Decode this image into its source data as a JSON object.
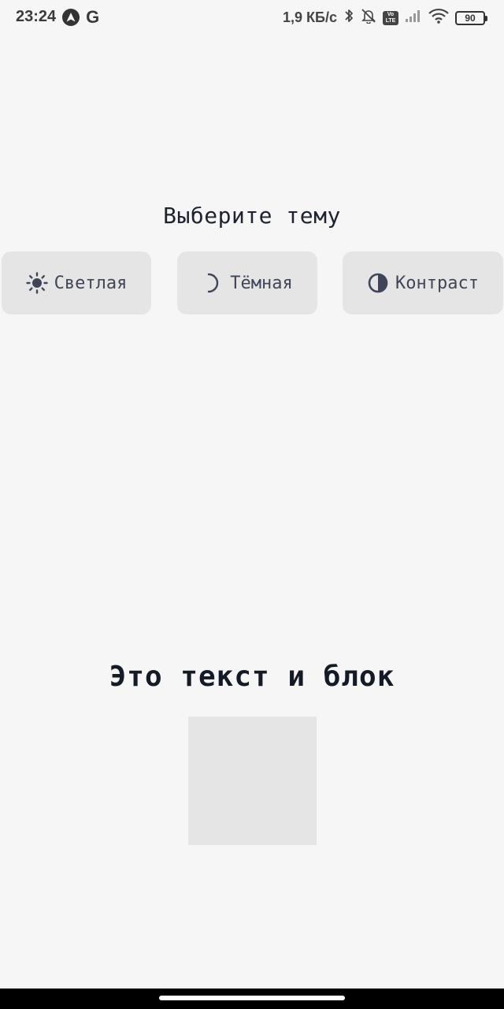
{
  "status_bar": {
    "time": "23:24",
    "google_letter": "G",
    "network_speed": "1,9 КБ/с",
    "lte_top": "Vo",
    "lte_bottom": "LTE",
    "battery_level": "90"
  },
  "theme_selector": {
    "title": "Выберите тему",
    "options": [
      {
        "label": "Светлая",
        "icon": "sun-icon"
      },
      {
        "label": "Тёмная",
        "icon": "moon-icon"
      },
      {
        "label": "Контраст",
        "icon": "contrast-icon"
      }
    ]
  },
  "sample": {
    "text": "Это текст и блок"
  },
  "colors": {
    "background": "#f6f6f6",
    "button_background": "#e5e5e5",
    "text_primary": "#1d2330",
    "icon_color": "#3f4658"
  }
}
